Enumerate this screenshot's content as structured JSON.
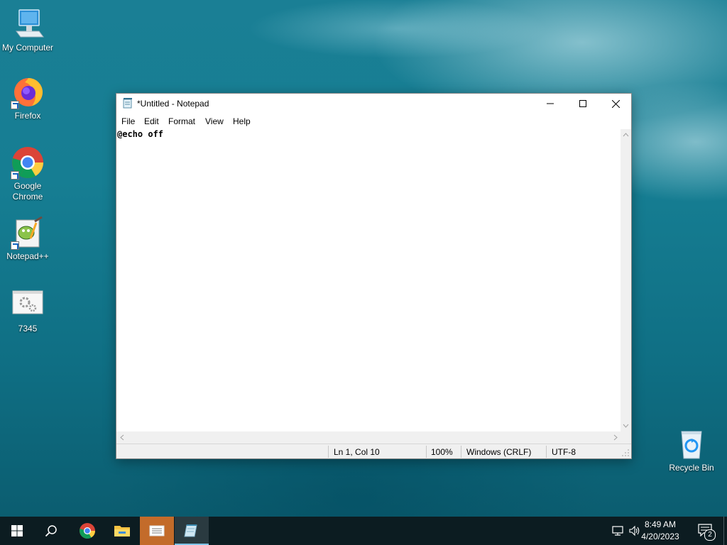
{
  "desktop": {
    "icons": [
      {
        "label": "My Computer"
      },
      {
        "label": "Firefox"
      },
      {
        "label": "Google Chrome"
      },
      {
        "label": "Notepad++"
      },
      {
        "label": "7345"
      },
      {
        "label": "Recycle Bin"
      }
    ]
  },
  "notepad": {
    "title": "*Untitled - Notepad",
    "menu": [
      "File",
      "Edit",
      "Format",
      "View",
      "Help"
    ],
    "content": "@echo off",
    "status": {
      "position": "Ln 1, Col 10",
      "zoom": "100%",
      "line_ending": "Windows (CRLF)",
      "encoding": "UTF-8"
    }
  },
  "taskbar": {
    "items": [
      "start-icon",
      "search-icon",
      "chrome-icon",
      "file-explorer-icon",
      "app-icon",
      "notepad-icon"
    ],
    "clock": {
      "time": "8:49 AM",
      "date": "4/20/2023"
    },
    "notifications_count": "2"
  }
}
